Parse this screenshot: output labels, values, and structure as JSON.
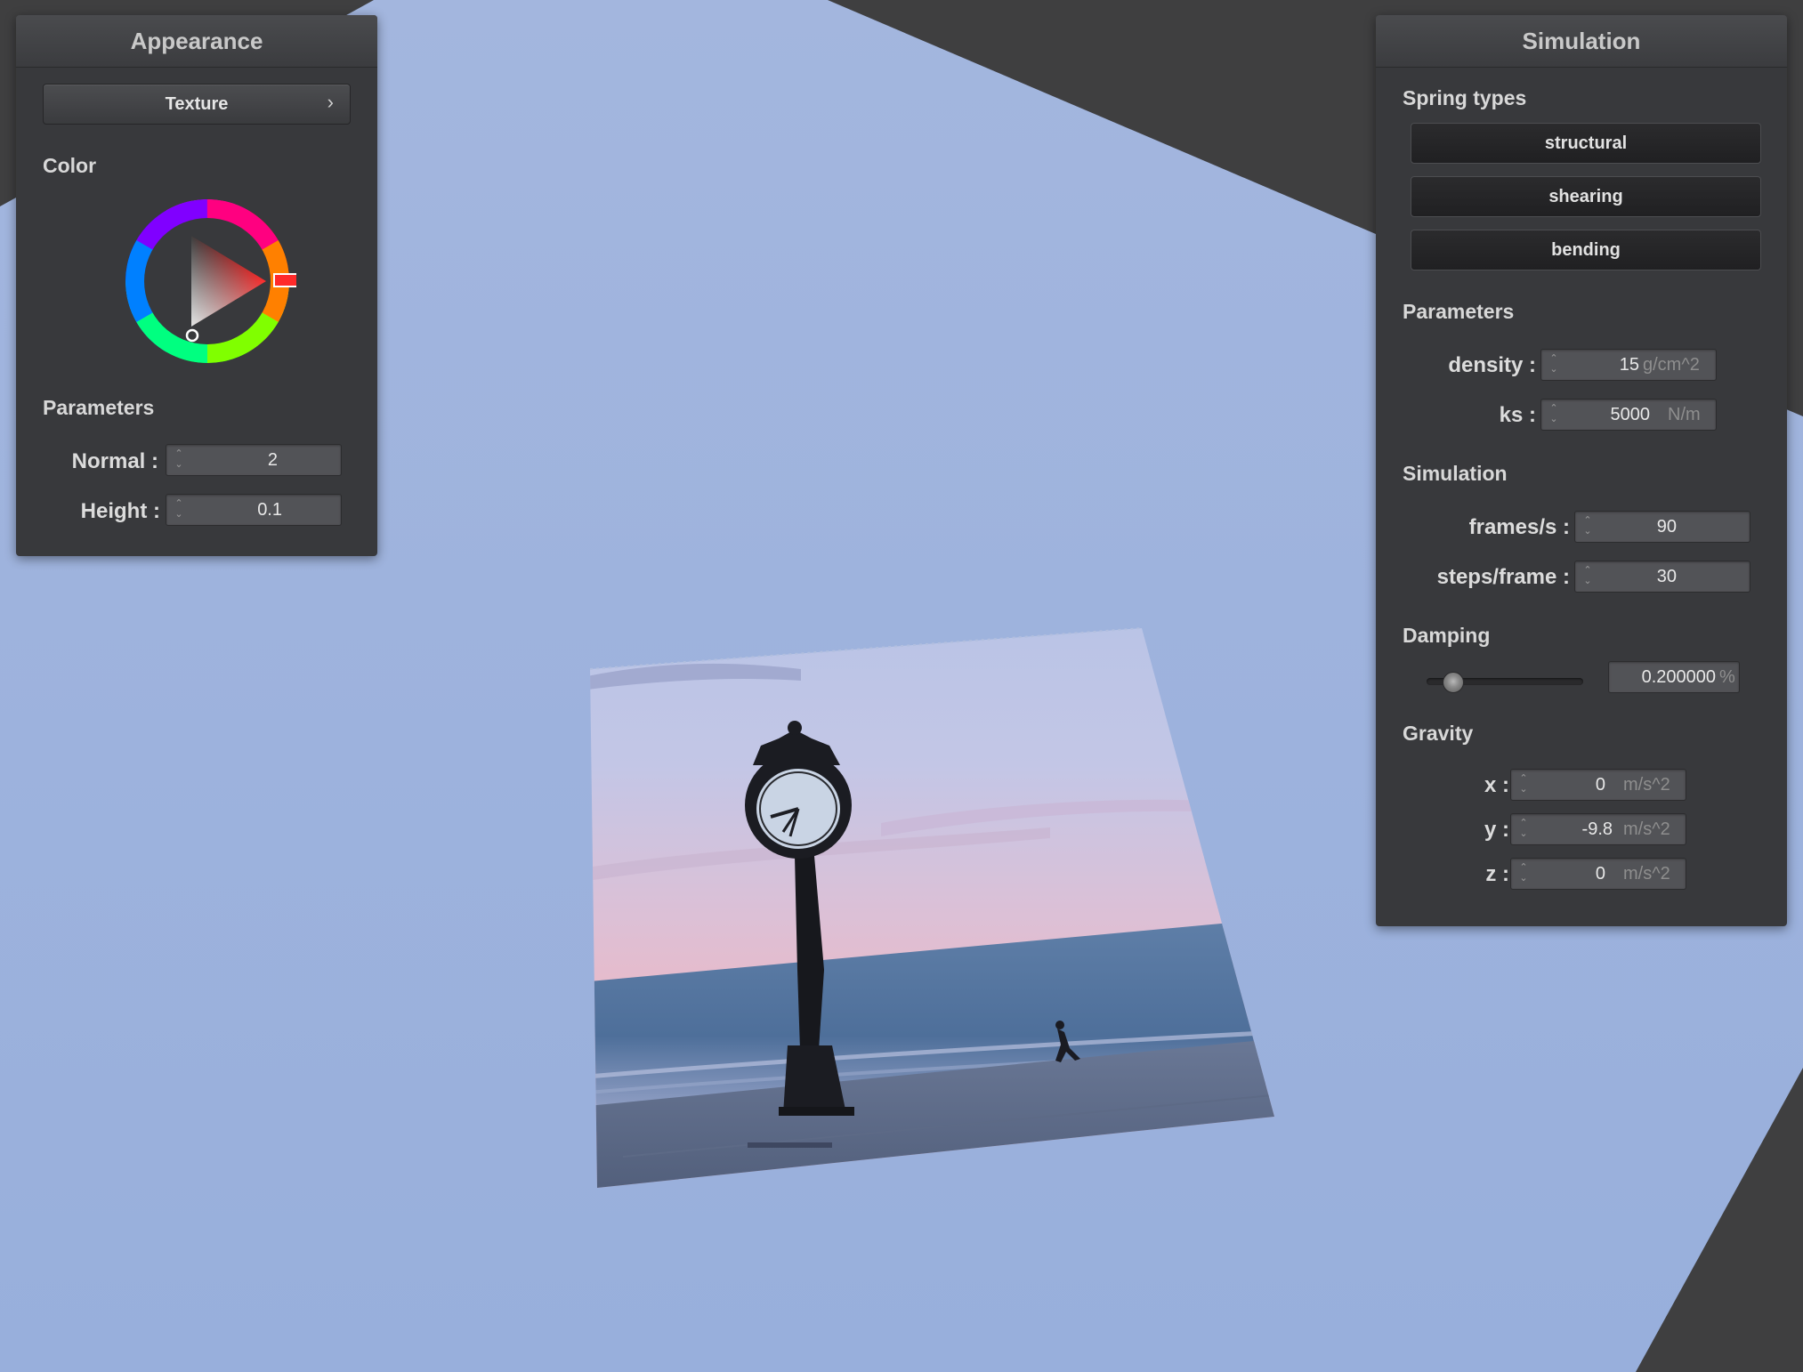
{
  "appearance": {
    "title": "Appearance",
    "texture_button": "Texture",
    "texture_chevron": "›",
    "color_label": "Color",
    "parameters_label": "Parameters",
    "normal_label": "Normal :",
    "normal_value": "2",
    "height_label": "Height :",
    "height_value": "0.1",
    "picked_color": "#ff1a1a"
  },
  "simulation": {
    "title": "Simulation",
    "spring_types_label": "Spring types",
    "spring_types": [
      "structural",
      "shearing",
      "bending"
    ],
    "parameters_label": "Parameters",
    "density_label": "density :",
    "density_value": "15",
    "density_unit": "g/cm^2",
    "ks_label": "ks :",
    "ks_value": "5000",
    "ks_unit": "N/m",
    "simulation_label": "Simulation",
    "fps_label": "frames/s :",
    "fps_value": "90",
    "steps_label": "steps/frame :",
    "steps_value": "30",
    "damping_label": "Damping",
    "damping_value": "0.200000",
    "damping_unit": "%",
    "damping_level": 0.2,
    "gravity_label": "Gravity",
    "gx_label": "x :",
    "gx_value": "0",
    "gy_label": "y :",
    "gy_value": "-9.8",
    "gz_label": "z :",
    "gz_value": "0",
    "gravity_unit": "m/s^2"
  },
  "icons": {
    "spinner": "spinner-arrows-icon",
    "chevron": "chevron-right-icon"
  }
}
